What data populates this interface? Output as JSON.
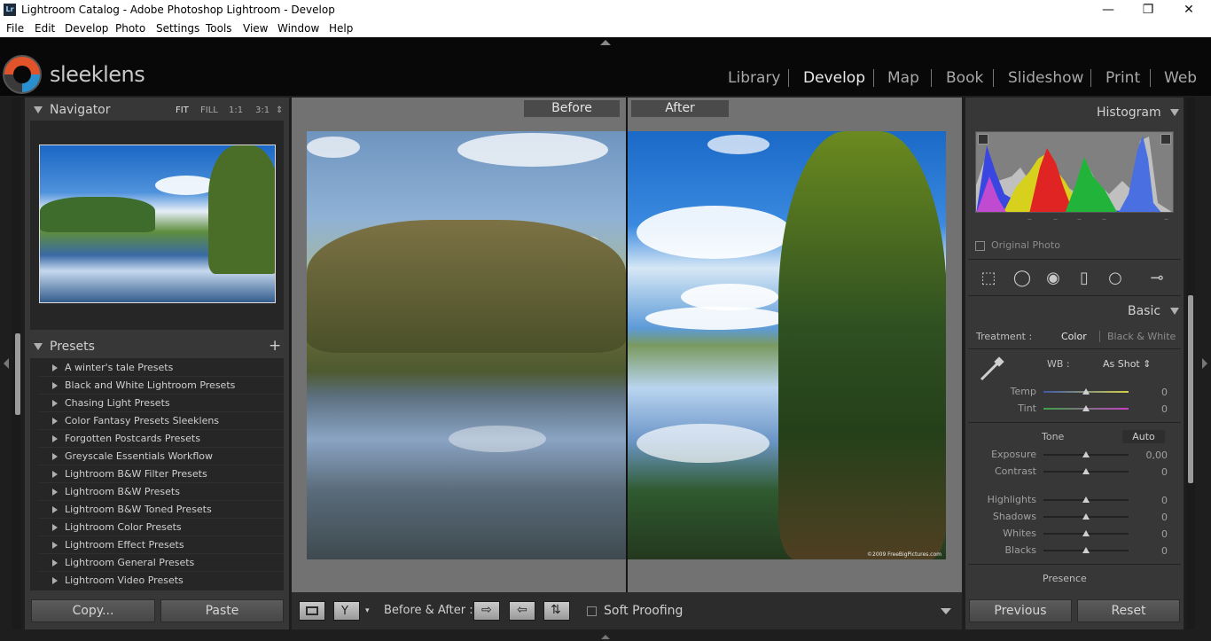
{
  "window": {
    "title": "Lightroom Catalog - Adobe Photoshop Lightroom - Develop",
    "app_icon": "Lr",
    "minimize": "—",
    "restore": "❐",
    "close": "✕"
  },
  "menu": [
    "File",
    "Edit",
    "Develop",
    "Photo",
    "Settings",
    "Tools",
    "View",
    "Window",
    "Help"
  ],
  "branding": {
    "logo_text": "sleeklens"
  },
  "modules": [
    "Library",
    "Develop",
    "Map",
    "Book",
    "Slideshow",
    "Print",
    "Web"
  ],
  "active_module": "Develop",
  "navigator": {
    "title": "Navigator",
    "options": [
      "FIT",
      "FILL",
      "1:1",
      "3:1"
    ],
    "active_option": "FIT"
  },
  "presets": {
    "title": "Presets",
    "add": "+",
    "items": [
      "A winter's tale Presets",
      "Black and White Lightroom Presets",
      "Chasing Light Presets",
      "Color Fantasy Presets Sleeklens",
      "Forgotten Postcards Presets",
      "Greyscale Essentials Workflow",
      "Lightroom B&W Filter Presets",
      "Lightroom B&W Presets",
      "Lightroom B&W Toned Presets",
      "Lightroom Color Presets",
      "Lightroom Effect Presets",
      "Lightroom General Presets",
      "Lightroom Video Presets"
    ]
  },
  "left_buttons": {
    "copy": "Copy...",
    "paste": "Paste"
  },
  "compare": {
    "before_label": "Before",
    "after_label": "After",
    "watermark": "©2009 FreeBigPictures.com"
  },
  "toolbar": {
    "before_after_label": "Before & After :",
    "soft_proofing": "Soft Proofing"
  },
  "histogram": {
    "title": "Histogram",
    "original_photo": "Original Photo",
    "dashes": [
      "–",
      "–",
      "–",
      "–",
      "–"
    ]
  },
  "basic": {
    "title": "Basic",
    "treatment_label": "Treatment :",
    "treatment_color": "Color",
    "treatment_bw": "Black & White",
    "wb_label": "WB :",
    "wb_value": "As Shot",
    "tone_label": "Tone",
    "auto_label": "Auto",
    "presence_label": "Presence",
    "sliders_wb": [
      {
        "label": "Temp",
        "value": "0"
      },
      {
        "label": "Tint",
        "value": "0"
      }
    ],
    "sliders_tone": [
      {
        "label": "Exposure",
        "value": "0,00"
      },
      {
        "label": "Contrast",
        "value": "0"
      }
    ],
    "sliders_tone2": [
      {
        "label": "Highlights",
        "value": "0"
      },
      {
        "label": "Shadows",
        "value": "0"
      },
      {
        "label": "Whites",
        "value": "0"
      },
      {
        "label": "Blacks",
        "value": "0"
      }
    ]
  },
  "right_buttons": {
    "previous": "Previous",
    "reset": "Reset"
  },
  "colors": {
    "panel": "#373737",
    "dark": "#262626",
    "accent_text": "#e9e9e9"
  }
}
